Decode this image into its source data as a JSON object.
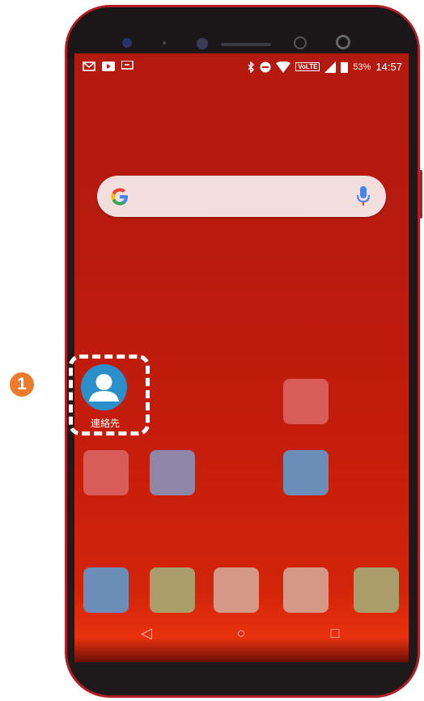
{
  "status_bar": {
    "left_icons": [
      "gmail-icon",
      "youtube-icon",
      "chat-icon"
    ],
    "right_icons": [
      "bluetooth-icon",
      "dnd-icon",
      "wifi-icon",
      "volte-icon",
      "signal-icon",
      "battery-icon"
    ],
    "volte_label": "VoLTE",
    "battery_percent": "53%",
    "time": "14:57"
  },
  "search_bar": {
    "logo": "google-logo",
    "mic": "mic-icon"
  },
  "app": {
    "label": "連絡先",
    "icon": "contacts-icon"
  },
  "callout": {
    "number": "1",
    "color": "#ee7a2b"
  },
  "tile_colors": {
    "row1": [
      "#d85c59"
    ],
    "row2": [
      "#d85c59",
      "#8f86a8",
      "#6b8eb9"
    ],
    "dock": [
      "#6b8eb9",
      "#ab9d6a",
      "#d59786",
      "#d59786",
      "#ab9d6a"
    ]
  },
  "navbar": {
    "back": "◁",
    "home": "○",
    "recents": "□"
  },
  "colors": {
    "accent": "#b31a10",
    "highlight": "#ffffff"
  }
}
